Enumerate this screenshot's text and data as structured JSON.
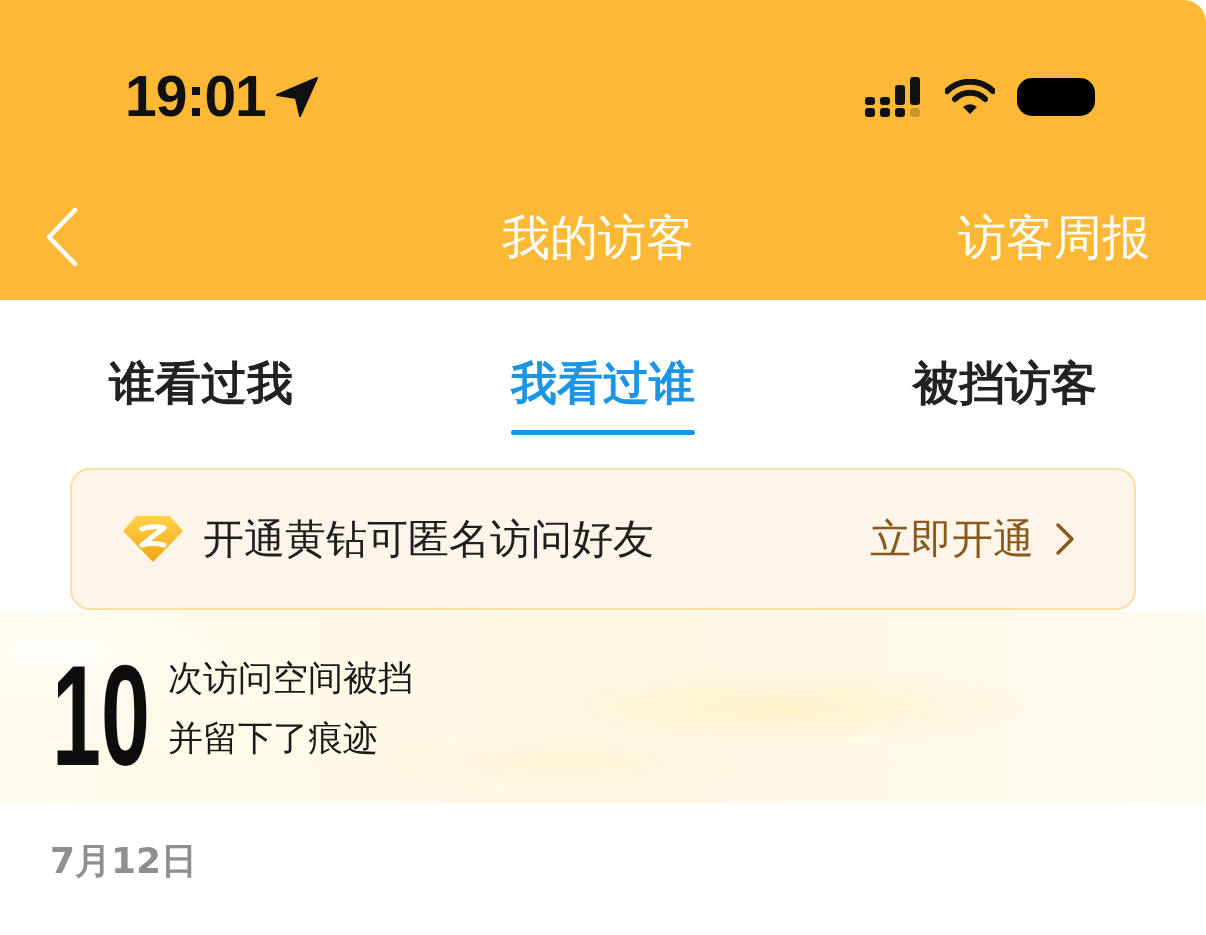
{
  "status_bar": {
    "time": "19:01"
  },
  "nav_bar": {
    "title": "我的访客",
    "action": "访客周报"
  },
  "tabs": [
    {
      "label": "谁看过我",
      "selected": false
    },
    {
      "label": "我看过谁",
      "selected": true
    },
    {
      "label": "被挡访客",
      "selected": false
    }
  ],
  "promo_banner": {
    "text": "开通黄钻可匿名访问好友",
    "action": "立即开通"
  },
  "blocked_summary": {
    "count": "10",
    "lines": [
      "次访问空间被挡",
      "并留下了痕迹"
    ]
  },
  "date_header": "7月12日"
}
